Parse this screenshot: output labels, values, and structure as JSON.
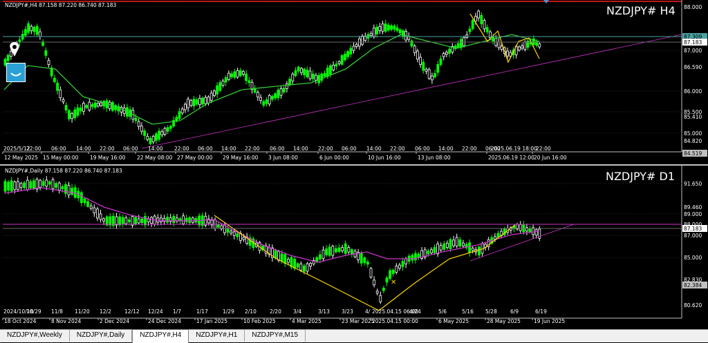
{
  "h4": {
    "header": "NZDJPY#,H4  87.158 87.220 86.740 87.183",
    "title": "NZDJPY# H4",
    "price_labels": [
      "88.000",
      "87.309",
      "87.183",
      "87.000",
      "86.590",
      "86.000",
      "85.500",
      "85.410",
      "85.000",
      "84.820",
      "84.519"
    ],
    "time_labels_top": [
      "2025/5/12",
      "22:00",
      "06:00",
      "14:00",
      "22:00",
      "06:00",
      "14:00",
      "22:00",
      "06:00",
      "14:00",
      "22:00",
      "06:00",
      "14:00",
      "22:00",
      "06:00",
      "14:00",
      "22:00",
      "06:00",
      "14:00",
      "22:00",
      "06:00",
      "2025.06.19 18:00",
      "22:00"
    ],
    "time_labels_bottom": [
      "12 May 2025",
      "15 May 00:00",
      "19 May 16:00",
      "22 May 08:00",
      "27 May 00:00",
      "29 May 16:00",
      "3 Jun 08:00",
      "6 Jun 00:00",
      "10 Jun 16:00",
      "13 Jun 08:00",
      "2025.06.19 12:00",
      "20 Jun 16:00"
    ]
  },
  "d1": {
    "header": "NZDJPY#,Daily  87.158 87.220 86.740 87.183",
    "title": "NZDJPY# D1",
    "price_labels": [
      "91.650",
      "89.460",
      "89.000",
      "88.000",
      "87.183",
      "87.000",
      "85.000",
      "82.830",
      "82.384",
      "80.620"
    ],
    "time_labels_top": [
      "2024/10/18",
      "10/29",
      "11/8",
      "11/20",
      "12/2",
      "12/12",
      "12/24",
      "1/7",
      "1/17",
      "1/29",
      "2/10",
      "2/20",
      "3/4",
      "3/13",
      "3/23",
      "4/",
      "2025.04.15 06:00",
      "4/24",
      "5/6",
      "5/16",
      "5/28",
      "6/9",
      "6/19"
    ],
    "time_labels_bottom": [
      "18 Oct 2024",
      "8 Nov 2024",
      "2 Dec 2024",
      "24 Dec 2024",
      "17 Jan 2025",
      "10 Feb 2025",
      "4 Mar 2025",
      "23 Mar 2025",
      "2025.04.15 00:00",
      "6 May 2025",
      "28 May 2025",
      "19 Jun 2025"
    ]
  },
  "tabs": [
    "NZDJPY#,Weekly",
    "NZDJPY#,Daily",
    "NZDJPY#,H4",
    "NZDJPY#,H1",
    "NZDJPY#,M15"
  ],
  "active_tab": "NZDJPY#,H4",
  "colors": {
    "bull": "#ffffff",
    "bear": "#00ff00",
    "ma_h4": "#32cd32",
    "ma_d1": "#cc33cc",
    "trend": "#cc33cc",
    "zigzag": "#ffd700",
    "level": "#4aa3a3",
    "redline": "#ff2020"
  },
  "icons": [
    "expert-advisor-icon",
    "smiley-icon"
  ]
}
